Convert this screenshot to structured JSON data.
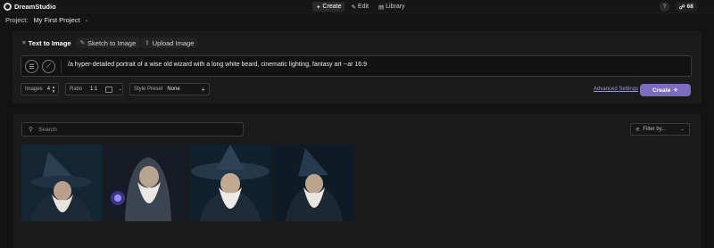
{
  "app": {
    "name": "DreamStudio",
    "nav": [
      {
        "label": "Create",
        "icon": "sparkle-icon",
        "active": true
      },
      {
        "label": "Edit",
        "icon": "pencil-icon",
        "active": false
      },
      {
        "label": "Library",
        "icon": "library-icon",
        "active": false
      }
    ],
    "help_label": "?",
    "credits": "68"
  },
  "project": {
    "label": "Project:",
    "name": "My First Project"
  },
  "tabs": [
    {
      "label": "Text to Image",
      "icon": "text-lines-icon",
      "active": true
    },
    {
      "label": "Sketch to Image",
      "icon": "pencil-icon",
      "active": false
    },
    {
      "label": "Upload Image",
      "icon": "upload-icon",
      "active": false
    }
  ],
  "prompt": {
    "text": "/a hyper-detailed portrait of a wise old wizard with a long white beard, cinematic lighting, fantasy art --ar 16:9"
  },
  "controls": {
    "images_label": "Images",
    "images_value": "4",
    "ratio_label": "Ratio",
    "ratio_value": "1:1",
    "style_label": "Style Preset",
    "style_value": "None"
  },
  "advanced_settings": "Advanced Settings",
  "create_button": "Create",
  "gallery": {
    "search_placeholder": "Search",
    "filter_label": "Filter by...",
    "images": [
      {
        "alt": "wizard portrait 1"
      },
      {
        "alt": "wizard portrait 2"
      },
      {
        "alt": "wizard portrait 3"
      },
      {
        "alt": "wizard portrait 4"
      }
    ]
  },
  "colors": {
    "accent": "#7d6bc0",
    "background": "#131313",
    "panel": "#1b1b1b"
  }
}
